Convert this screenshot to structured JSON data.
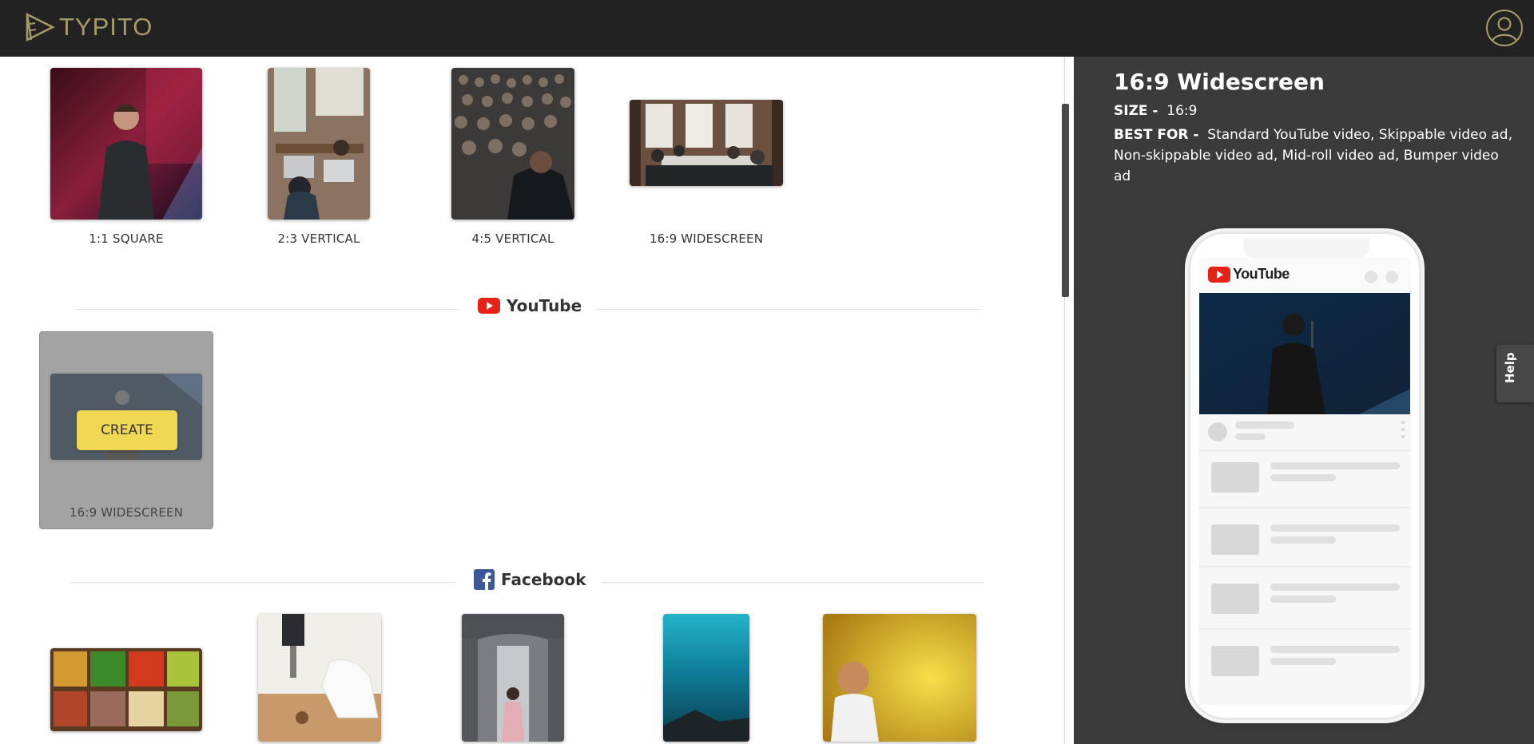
{
  "app": {
    "name": "TYPITO"
  },
  "colors": {
    "brand_gold": "#a79a66",
    "create_yellow": "#f0d855",
    "youtube_red": "#e62117",
    "facebook_blue": "#3b5998"
  },
  "top_formats": [
    {
      "label": "1:1 SQUARE"
    },
    {
      "label": "2:3 VERTICAL"
    },
    {
      "label": "4:5 VERTICAL"
    },
    {
      "label": "16:9 WIDESCREEN"
    }
  ],
  "youtube_section": {
    "title": "YouTube",
    "icon": "youtube-icon",
    "selected_card": {
      "label": "16:9 WIDESCREEN",
      "button": "CREATE"
    }
  },
  "facebook_section": {
    "title": "Facebook",
    "icon": "facebook-icon"
  },
  "panel": {
    "title": "16:9 Widescreen",
    "size_label": "SIZE -",
    "size_value": "16:9",
    "best_for_label": "BEST FOR -",
    "best_for_value": "Standard YouTube video, Skippable video ad, Non-skippable video ad, Mid-roll video ad, Bumper video ad",
    "phone_app": "YouTube"
  },
  "help": {
    "label": "Help"
  }
}
